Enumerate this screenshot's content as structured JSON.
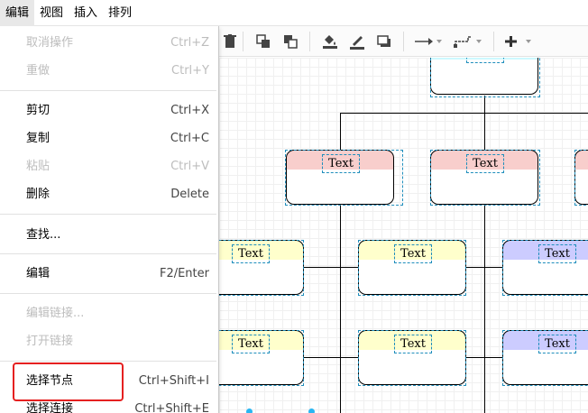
{
  "menubar": {
    "items": [
      "编辑",
      "视图",
      "插入",
      "排列"
    ]
  },
  "edit_menu": {
    "undo": {
      "label": "取消操作",
      "shortcut": "Ctrl+Z"
    },
    "redo": {
      "label": "重做",
      "shortcut": "Ctrl+Y"
    },
    "cut": {
      "label": "剪切",
      "shortcut": "Ctrl+X"
    },
    "copy": {
      "label": "复制",
      "shortcut": "Ctrl+C"
    },
    "paste": {
      "label": "粘贴",
      "shortcut": "Ctrl+V"
    },
    "delete": {
      "label": "删除",
      "shortcut": "Delete"
    },
    "find": {
      "label": "查找..."
    },
    "edit": {
      "label": "编辑",
      "shortcut": "F2/Enter"
    },
    "edit_link": {
      "label": "编辑链接..."
    },
    "open_link": {
      "label": "打开链接"
    },
    "select_vertices": {
      "label": "选择节点",
      "shortcut": "Ctrl+Shift+I"
    },
    "select_edges": {
      "label": "选择连接",
      "shortcut": "Ctrl+Shift+E"
    }
  },
  "toolbar": {
    "icons": [
      "delete-icon",
      "to-front-icon",
      "to-back-icon",
      "fill-color-icon",
      "line-color-icon",
      "shadow-icon",
      "connection-arrow-icon",
      "waypoints-icon",
      "insert-plus-icon"
    ]
  },
  "canvas": {
    "node_label": "Text",
    "colors": {
      "blue": "#cdf9ff",
      "red": "#f8cecc",
      "yellow": "#ffffcc",
      "purple": "#ccccff",
      "selection": "#1f8ebc",
      "highlight": "#e52020"
    }
  }
}
